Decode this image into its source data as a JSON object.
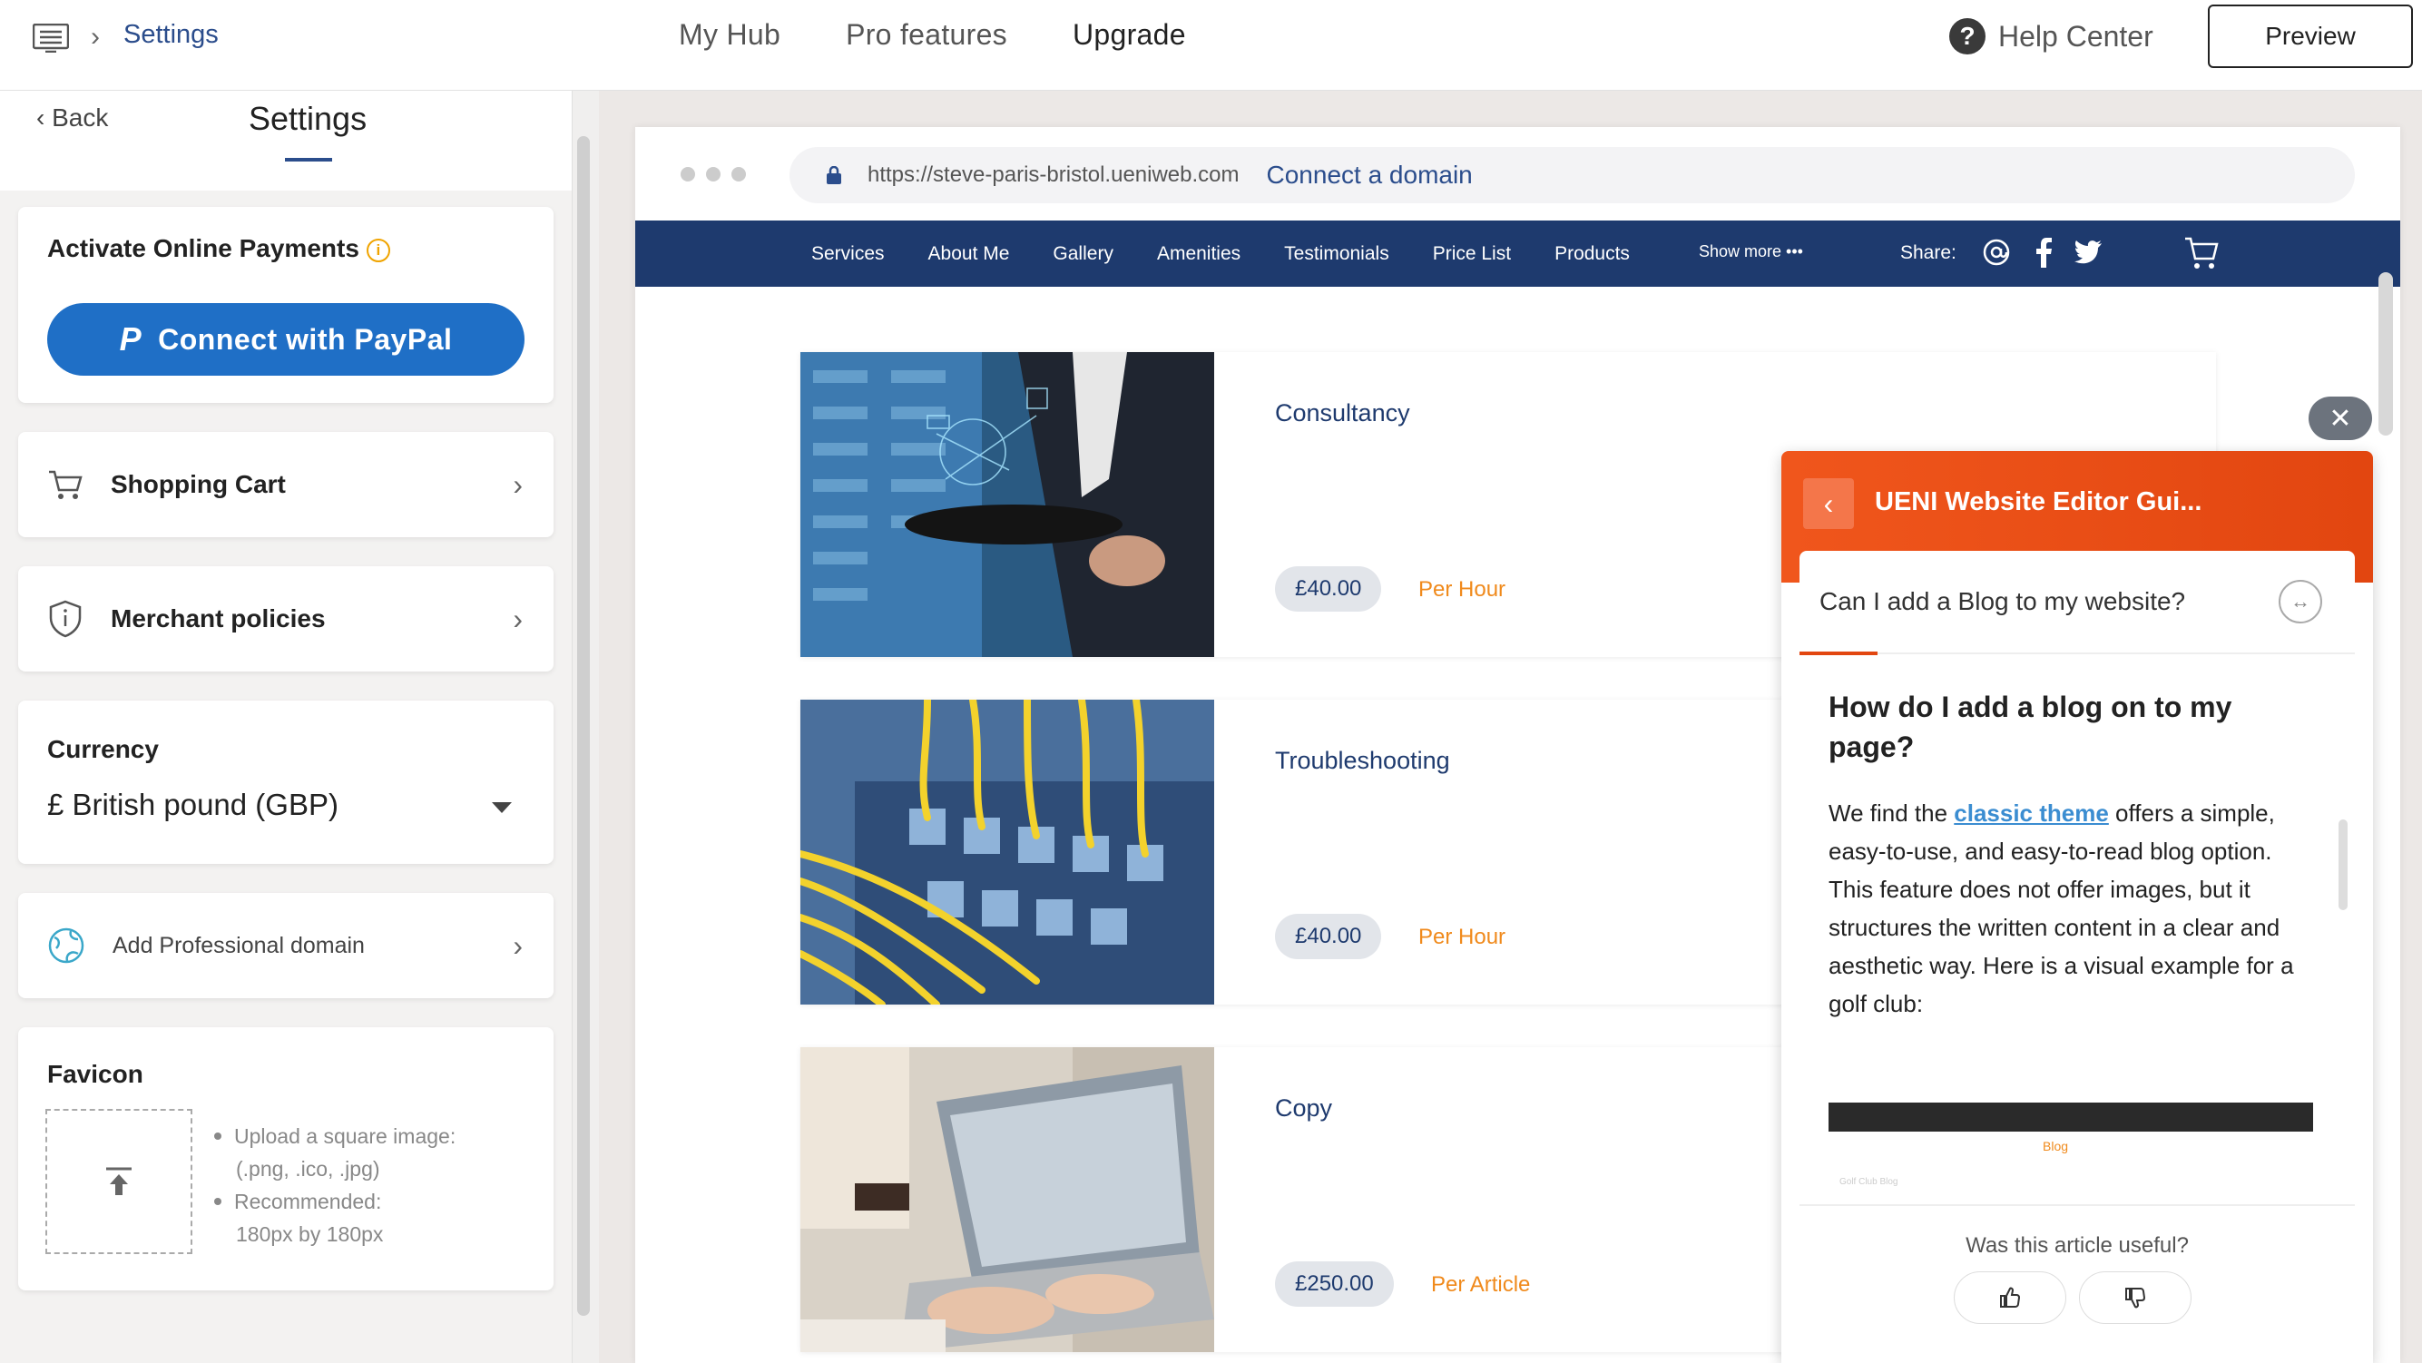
{
  "topbar": {
    "breadcrumb": "Settings",
    "nav": [
      "My Hub",
      "Pro features",
      "Upgrade"
    ],
    "help": "Help Center",
    "preview": "Preview"
  },
  "sidebar": {
    "back": "Back",
    "title": "Settings",
    "payments": {
      "title": "Activate Online Payments",
      "button": "Connect with PayPal"
    },
    "shopping_cart": "Shopping Cart",
    "merchant_policies": "Merchant policies",
    "currency": {
      "label": "Currency",
      "value": "£ British pound (GBP)"
    },
    "domain": "Add Professional domain",
    "favicon": {
      "title": "Favicon",
      "note1": "Upload a square image:",
      "note1b": "(.png, .ico, .jpg)",
      "note2": "Recommended:",
      "note2b": "180px by 180px"
    }
  },
  "preview": {
    "url": "https://steve-paris-bristol.ueniweb.com",
    "connect": "Connect a domain",
    "nav": [
      "Services",
      "About Me",
      "Gallery",
      "Amenities",
      "Testimonials",
      "Price List",
      "Products"
    ],
    "show_more": "Show more •••",
    "share": "Share:",
    "services": [
      {
        "name": "Consultancy",
        "price": "£40.00",
        "unit": "Per Hour"
      },
      {
        "name": "Troubleshooting",
        "price": "£40.00",
        "unit": "Per Hour"
      },
      {
        "name": "Copy",
        "price": "£250.00",
        "unit": "Per Article"
      }
    ]
  },
  "widget": {
    "title": "UENI Website Editor Gui...",
    "question": "Can I add a Blog to my website?",
    "heading": "How do I add a blog on to my page?",
    "body_before": "We find the ",
    "link": "classic theme",
    "body_after": " offers a simple, easy-to-use, and easy-to-read blog option. This feature does not offer images, but it structures the written content in a clear and aesthetic way. Here is a visual example for a golf club:",
    "mini_blog": "Blog",
    "mini_sub": "Golf Club Blog",
    "useful": "Was this article useful?"
  },
  "colors": {
    "accent_blue": "#2b4d8c",
    "paypal_blue": "#1f6fc6",
    "site_nav": "#1e3a6e",
    "widget_orange": "#e24610",
    "price_orange": "#f08a1c"
  }
}
